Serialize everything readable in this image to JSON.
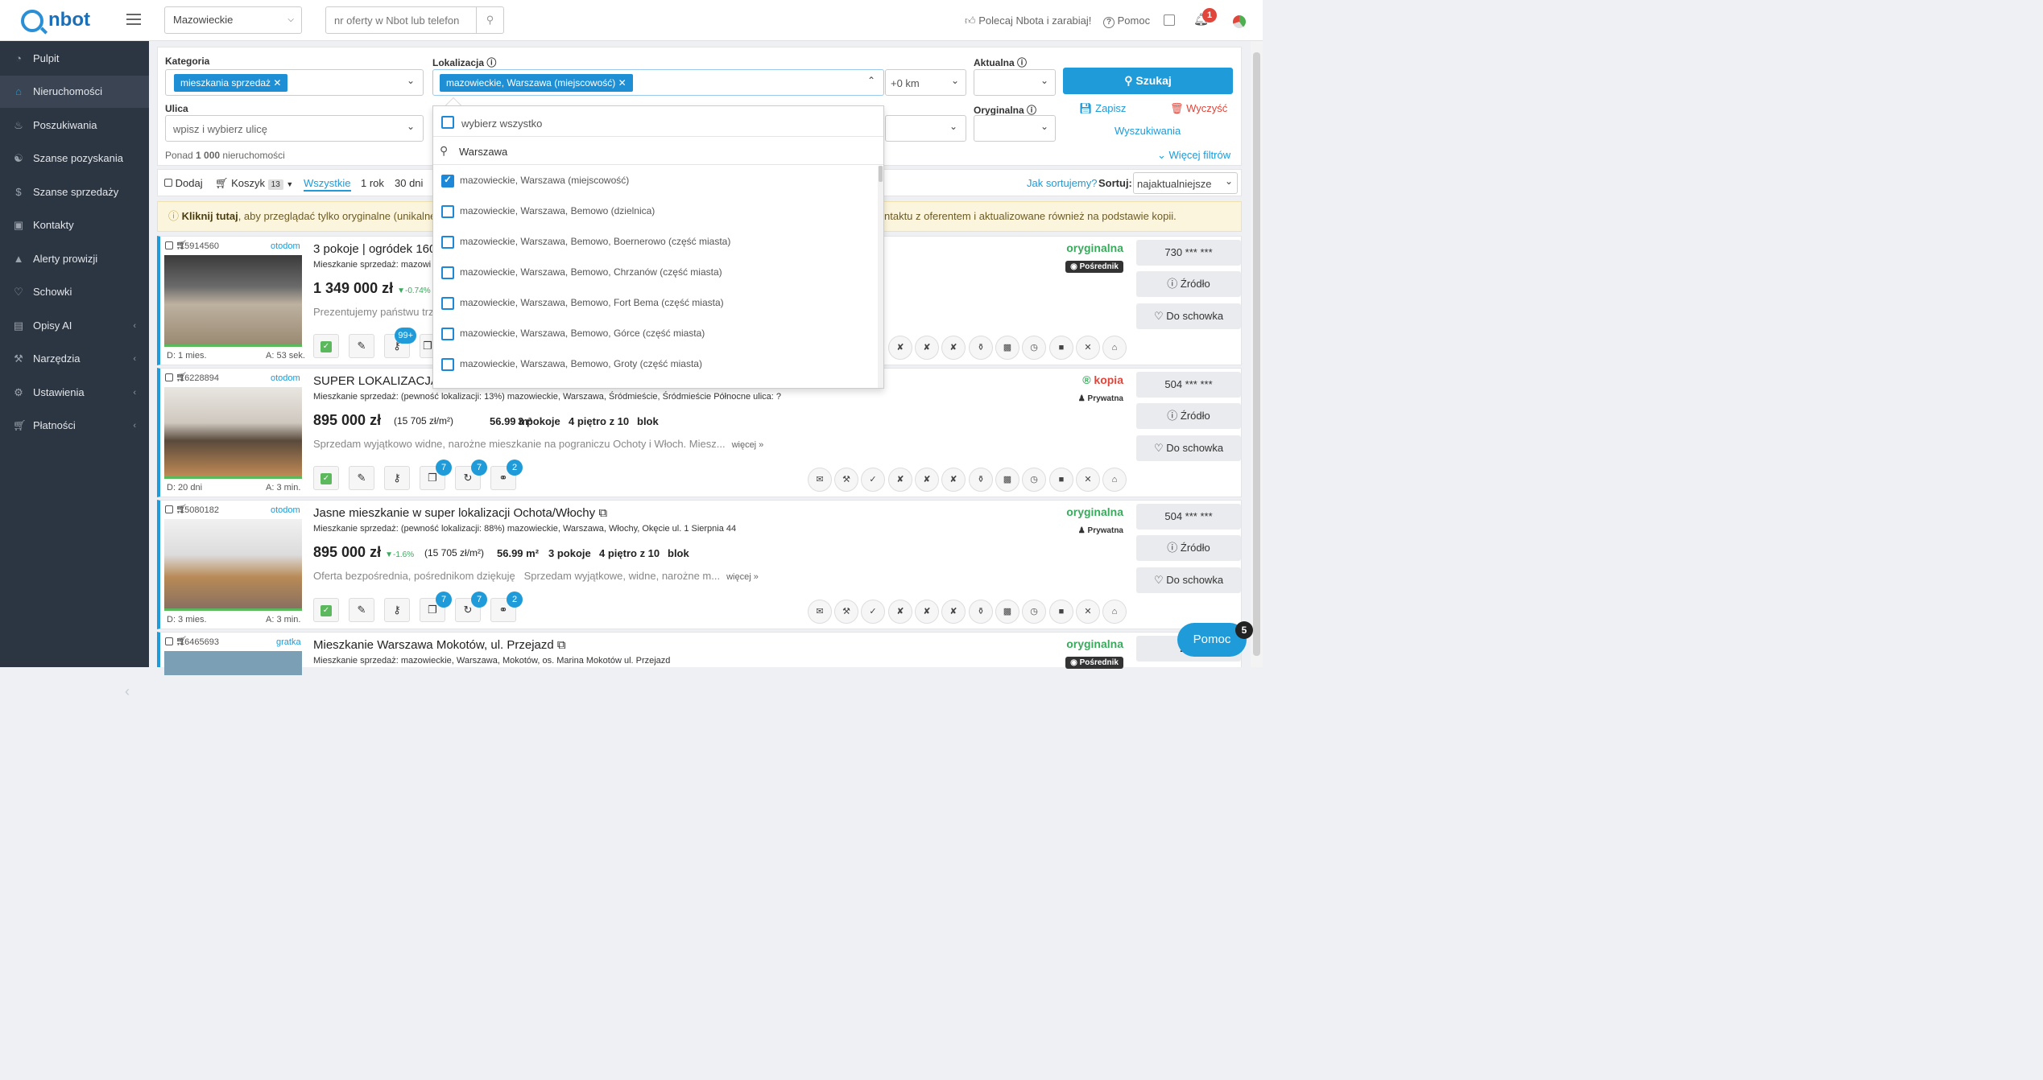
{
  "app": {
    "logo": "nbot"
  },
  "topbar": {
    "region_select": "Mazowieckie",
    "search_placeholder": "nr oferty w Nbot lub telefon",
    "recommend": "Polecaj Nbota i zarabiaj!",
    "help": "Pomoc",
    "notifications_count": "1"
  },
  "sidebar": {
    "items": [
      {
        "label": "Pulpit",
        "icon": "dashboard-icon"
      },
      {
        "label": "Nieruchomości",
        "icon": "home-icon"
      },
      {
        "label": "Poszukiwania",
        "icon": "bell-icon"
      },
      {
        "label": "Szanse pozyskania",
        "icon": "handshake-icon"
      },
      {
        "label": "Szanse sprzedaży",
        "icon": "dollar-icon"
      },
      {
        "label": "Kontakty",
        "icon": "contacts-icon"
      },
      {
        "label": "Alerty prowizji",
        "icon": "warning-icon"
      },
      {
        "label": "Schowki",
        "icon": "heart-icon"
      },
      {
        "label": "Opisy AI",
        "icon": "ai-icon"
      },
      {
        "label": "Narzędzia",
        "icon": "wrench-icon"
      },
      {
        "label": "Ustawienia",
        "icon": "gear-icon"
      },
      {
        "label": "Płatności",
        "icon": "cart-icon"
      }
    ]
  },
  "filters": {
    "category_label": "Kategoria",
    "category_tag": "mieszkania sprzedaż",
    "location_label": "Lokalizacja",
    "location_tag": "mazowieckie, Warszawa (miejscowość)",
    "distance": "+0 km",
    "current_label": "Aktualna",
    "original_label": "Oryginalna",
    "search_button": "Szukaj",
    "street_label": "Ulica",
    "street_placeholder": "wpisz i wybierz ulicę",
    "count_prefix": "Ponad",
    "count_value": "1 000",
    "count_suffix": "nieruchomości",
    "save": "Zapisz",
    "clear": "Wyczyść",
    "searches": "Wyszukiwania",
    "more_filters": "Więcej filtrów"
  },
  "toolbar": {
    "add": "Dodaj",
    "basket": "Koszyk",
    "basket_count": "13",
    "tab_all": "Wszystkie",
    "tab_year": "1 rok",
    "tab_30": "30 dni",
    "how_sort": "Jak sortujemy?",
    "sort_label": "Sortuj:",
    "sort_value": "najaktualniejsze"
  },
  "note": {
    "bold": "Kliknij tutaj",
    "text_left": ", aby przeglądać tylko oryginalne (unikalne",
    "text_right": "ntaktu z oferentem i aktualizowane również na podstawie kopii."
  },
  "dropdown": {
    "select_all": "wybierz wszystko",
    "search_value": "Warszawa",
    "items": [
      {
        "label": "mazowieckie, Warszawa (miejscowość)",
        "checked": true
      },
      {
        "label": "mazowieckie, Warszawa, Bemowo (dzielnica)",
        "checked": false
      },
      {
        "label": "mazowieckie, Warszawa, Bemowo, Boernerowo (część miasta)",
        "checked": false
      },
      {
        "label": "mazowieckie, Warszawa, Bemowo, Chrzanów (część miasta)",
        "checked": false
      },
      {
        "label": "mazowieckie, Warszawa, Bemowo, Fort Bema (część miasta)",
        "checked": false
      },
      {
        "label": "mazowieckie, Warszawa, Bemowo, Górce (część miasta)",
        "checked": false
      },
      {
        "label": "mazowieckie, Warszawa, Bemowo, Groty (część miasta)",
        "checked": false
      }
    ]
  },
  "listings": [
    {
      "id": "15914560",
      "source": "otodom",
      "title": "3 pokoje | ogródek 160",
      "desc": "Mieszkanie sprzedaż: mazowi",
      "price": "1 349 000 zł",
      "change": "-0.74%",
      "text": "Prezentujemy państwu trzy",
      "date": "D: 1 mies.",
      "age": "A: 53 sek.",
      "status": "oryginalna",
      "agent": "Pośrednik",
      "phone": "730 *** ***",
      "badge1": "99+"
    },
    {
      "id": "16228894",
      "source": "otodom",
      "title": "SUPER LOKALIZACJA N",
      "desc": "Mieszkanie sprzedaż: (pewność lokalizacji: 13%) mazowieckie, Warszawa, Śródmieście, Śródmieście Północne ulica: ?",
      "price": "895 000 zł",
      "per_m": "(15 705 zł/m²)",
      "area": "56.99 m²",
      "rooms": "3 pokoje",
      "floor": "4 piętro z 10",
      "type": "blok",
      "text": "Sprzedam wyjątkowo widne, narożne mieszkanie na pograniczu Ochoty i Włoch. Miesz...",
      "more": "więcej »",
      "date": "D: 20 dni",
      "age": "A: 3 min.",
      "status": "kopia",
      "agent": "Prywatna",
      "phone": "504 *** ***",
      "badges": [
        "7",
        "7",
        "2"
      ]
    },
    {
      "id": "15080182",
      "source": "otodom",
      "title": "Jasne mieszkanie w super lokalizacji Ochota/Włochy",
      "desc": "Mieszkanie sprzedaż: (pewność lokalizacji: 88%) mazowieckie, Warszawa, Włochy, Okęcie ul. 1 Sierpnia 44",
      "price": "895 000 zł",
      "change": "-1.6%",
      "per_m": "(15 705 zł/m²)",
      "area": "56.99 m²",
      "rooms": "3 pokoje",
      "floor": "4 piętro z 10",
      "type": "blok",
      "text": "Oferta bezpośrednia, pośrednikom dziękuję   Sprzedam wyjątkowe, widne, narożne m...",
      "more": "więcej »",
      "date": "D: 3 mies.",
      "age": "A: 3 min.",
      "status": "oryginalna",
      "agent": "Prywatna",
      "phone": "504 *** ***",
      "badges": [
        "7",
        "7",
        "2"
      ]
    },
    {
      "id": "16465693",
      "source": "gratka",
      "title": "Mieszkanie Warszawa Mokotów, ul. Przejazd",
      "desc": "Mieszkanie sprzedaż: mazowieckie, Warszawa, Mokotów, os. Marina Mokotów ul. Przejazd",
      "status": "oryginalna",
      "agent": "Pośrednik",
      "phone": "226"
    }
  ],
  "actions": {
    "source": "Źródło",
    "save": "Do schowka"
  },
  "help_float": {
    "label": "Pomoc",
    "count": "5"
  },
  "colors": {
    "accent": "#1e9bd8",
    "sidebar": "#2c3542",
    "green": "#3aaa5c",
    "red": "#e0463b"
  }
}
